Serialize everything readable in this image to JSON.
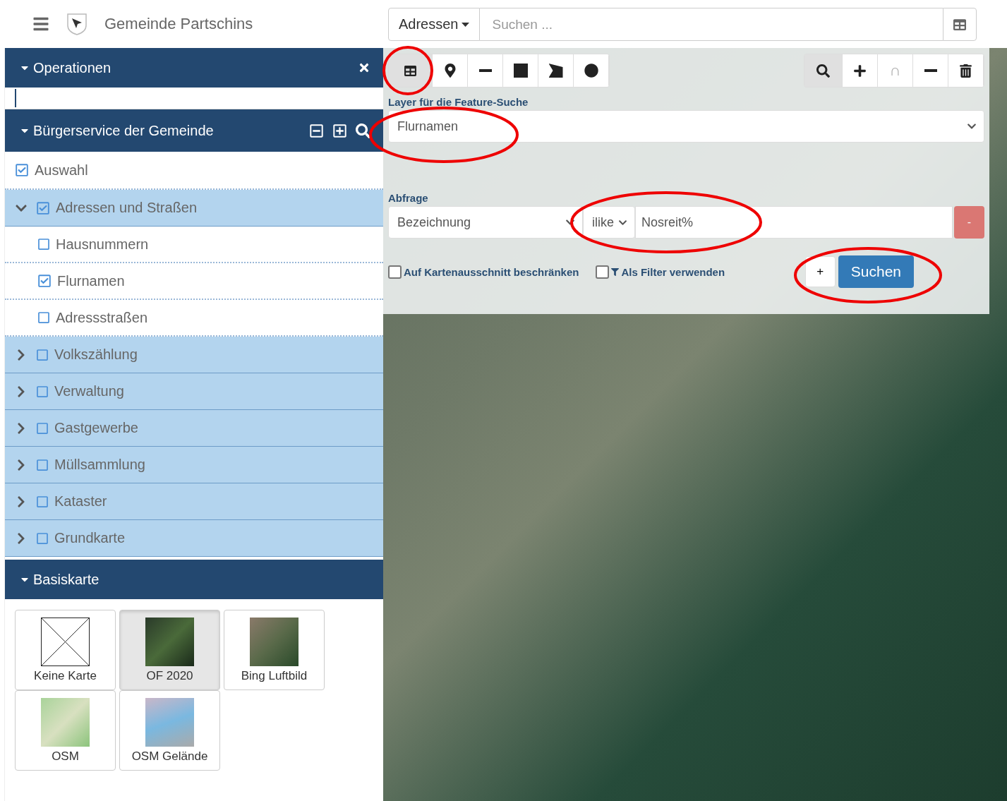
{
  "header": {
    "title": "Gemeinde Partschins"
  },
  "search": {
    "category": "Adressen",
    "placeholder": "Suchen ..."
  },
  "panels": {
    "operations": {
      "title": "Operationen",
      "expanded": true
    },
    "layers": {
      "title": "Bürgerservice der Gemeinde",
      "expanded": true,
      "tree": [
        {
          "kind": "item",
          "label": "Auswahl",
          "checked": true
        },
        {
          "kind": "group",
          "label": "Adressen und Straßen",
          "checked": true,
          "expanded": true,
          "children": [
            {
              "kind": "item",
              "label": "Hausnummern",
              "checked": false
            },
            {
              "kind": "item",
              "label": "Flurnamen",
              "checked": true
            },
            {
              "kind": "item",
              "label": "Adressstraßen",
              "checked": false
            }
          ]
        },
        {
          "kind": "group",
          "label": "Volkszählung",
          "checked": false,
          "expanded": false
        },
        {
          "kind": "group",
          "label": "Verwaltung",
          "checked": false,
          "expanded": false
        },
        {
          "kind": "group",
          "label": "Gastgewerbe",
          "checked": false,
          "expanded": false
        },
        {
          "kind": "group",
          "label": "Müllsammlung",
          "checked": false,
          "expanded": false
        },
        {
          "kind": "group",
          "label": "Kataster",
          "checked": false,
          "expanded": false
        },
        {
          "kind": "group",
          "label": "Grundkarte",
          "checked": false,
          "expanded": false
        }
      ]
    },
    "basemap": {
      "title": "Basiskarte",
      "expanded": true,
      "tiles": [
        {
          "kind": "none",
          "label": "Keine Karte",
          "selected": false
        },
        {
          "kind": "image",
          "label": "OF 2020",
          "selected": true
        },
        {
          "kind": "image",
          "label": "Bing Luftbild",
          "selected": false
        },
        {
          "kind": "image",
          "label": "OSM",
          "selected": false
        },
        {
          "kind": "image",
          "label": "OSM Gelände",
          "selected": false
        }
      ]
    }
  },
  "map_tools": {
    "draw": [
      {
        "kind": "table",
        "selected": true
      },
      {
        "kind": "pin",
        "selected": false
      },
      {
        "kind": "line",
        "selected": false
      },
      {
        "kind": "square",
        "selected": false
      },
      {
        "kind": "polygon",
        "selected": false
      },
      {
        "kind": "circle",
        "selected": false
      }
    ],
    "select": [
      {
        "kind": "search",
        "selected": true
      },
      {
        "kind": "plus",
        "selected": false
      },
      {
        "kind": "text",
        "label": "∩",
        "selected": false,
        "disabled": true
      },
      {
        "kind": "minus",
        "selected": false
      },
      {
        "kind": "trash",
        "selected": false
      }
    ]
  },
  "feature_search": {
    "layer_label": "Layer für die Feature-Suche",
    "layer": "Flurnamen",
    "query_label": "Abfrage",
    "query": {
      "field": "Bezeichnung",
      "operator": "ilike",
      "value": "Nosreit%",
      "remove": "-"
    },
    "options": [
      {
        "label": "Auf Kartenausschnitt beschränken",
        "checked": false,
        "icon": false
      },
      {
        "label": "Als Filter verwenden",
        "checked": false,
        "icon": true
      }
    ],
    "add": "+",
    "submit": "Suchen"
  },
  "annotations": [
    {
      "kind": "ellipse"
    },
    {
      "kind": "ellipse"
    },
    {
      "kind": "ellipse"
    },
    {
      "kind": "ellipse"
    }
  ]
}
